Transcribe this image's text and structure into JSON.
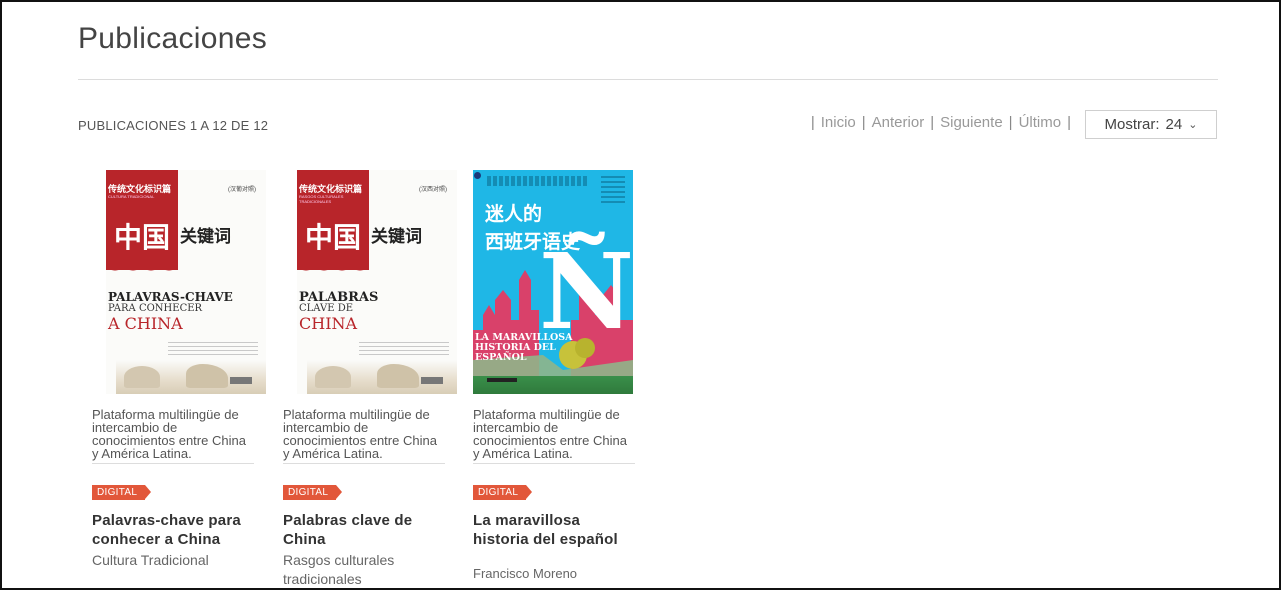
{
  "header": {
    "title": "Publicaciones"
  },
  "toolbar": {
    "count_label": "PUBLICACIONES 1 A 12 DE 12",
    "pager": {
      "separator": "|",
      "first": "Inicio",
      "prev": "Anterior",
      "next": "Siguiente",
      "last": "Último"
    },
    "show": {
      "label": "Mostrar:",
      "value": "24"
    }
  },
  "colors": {
    "badge": "#e2573a",
    "cover_red": "#b8252a",
    "cover_blue": "#1fb7e6"
  },
  "books": [
    {
      "cover": {
        "cn_banner": "传统文化标识篇",
        "banner_latin": "CULTURA TRADICIONAL",
        "corner_tag": "(汉葡对照)",
        "cn_big": "中国",
        "cn_right": "关键词",
        "latin_1": "PALAVRAS-CHAVE",
        "latin_2": "PARA CONHECER",
        "latin_3": "A CHINA"
      },
      "description": "Plataforma multilingüe de intercambio de conocimientos entre China y América Latina.",
      "badge": "DIGITAL",
      "title": "Palavras-chave para conhecer a China",
      "subtitle": "Cultura Tradicional"
    },
    {
      "cover": {
        "cn_banner": "传统文化标识篇",
        "banner_latin": "RASGOS CULTURALES TRADICIONALES",
        "corner_tag": "(汉西对照)",
        "cn_big": "中国",
        "cn_right": "关键词",
        "latin_1": "PALABRAS",
        "latin_2": "CLAVE DE",
        "latin_3": "CHINA"
      },
      "description": "Plataforma multilingüe de intercambio de conocimientos entre China y América Latina.",
      "badge": "DIGITAL",
      "title": "Palabras clave de China",
      "subtitle": "Rasgos culturales tradicionales"
    },
    {
      "cover": {
        "cn_title_1": "迷人的",
        "cn_title_2": "西班牙语史",
        "big_letter": "Ñ",
        "latin_1": "LA MARAVILLOSA",
        "latin_2": "HISTORIA DEL",
        "latin_3": "ESPAÑOL"
      },
      "description": "Plataforma multilingüe de intercambio de conocimientos entre China y América Latina.",
      "badge": "DIGITAL",
      "title": "La maravillosa historia del español",
      "author": "Francisco Moreno"
    }
  ]
}
